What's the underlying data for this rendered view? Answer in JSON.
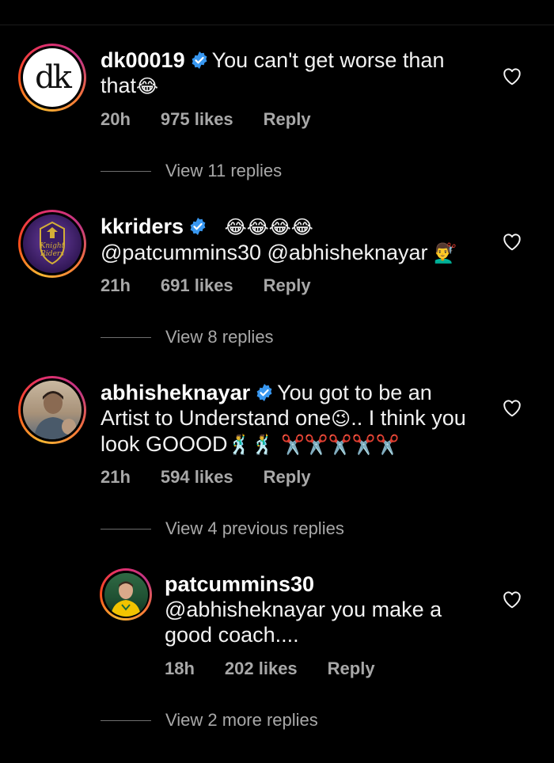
{
  "comments": [
    {
      "username": "dk00019",
      "verified": true,
      "avatar_text": "dk",
      "text": "You can't get worse than that",
      "emoji": "😂",
      "time": "20h",
      "likes": "975 likes",
      "reply": "Reply",
      "view_replies": "View 11 replies"
    },
    {
      "username": "kkriders",
      "verified": true,
      "avatar_text": "Knight Riders",
      "text_emoji": "😂😂😂😂",
      "text": "@patcummins30 @abhisheknayar",
      "emoji": "💇‍♂️",
      "time": "21h",
      "likes": "691 likes",
      "reply": "Reply",
      "view_replies": "View 8 replies"
    },
    {
      "username": "abhisheknayar",
      "verified": true,
      "text_line1": "You got to be an",
      "text_line2a": "Artist to Understand one",
      "emoji_wink": "😉",
      "text_line2b": ".. I think you",
      "text_line3": "look GOOOD",
      "emoji_tail": "🕺🕺 ✂️✂️✂️✂️✂️",
      "time": "21h",
      "likes": "594 likes",
      "reply": "Reply",
      "view_replies": "View 4 previous replies"
    },
    {
      "username": "patcummins30",
      "verified": false,
      "mention": "@abhisheknayar",
      "text_line1": "you make a",
      "text_line2": "good coach....",
      "time": "18h",
      "likes": "202 likes",
      "reply": "Reply",
      "view_replies": "View 2 more replies"
    }
  ],
  "colors": {
    "background": "#000000",
    "text": "#f2f2f2",
    "secondary": "#a8a8a8",
    "verified": "#3897f0"
  },
  "icons": {
    "like": "heart-outline-icon",
    "verified": "verified-badge-icon"
  }
}
